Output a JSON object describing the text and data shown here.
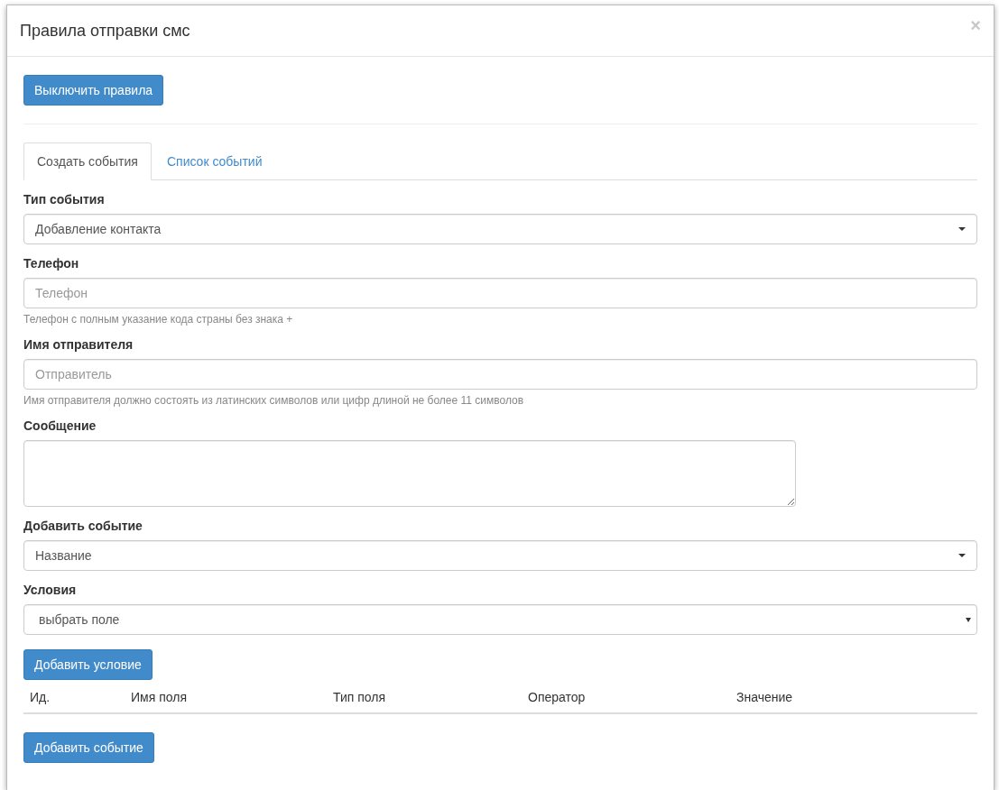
{
  "window": {
    "title": "Правила отправки смс",
    "close": "×"
  },
  "toggle_button": "Выключить правила",
  "tabs": [
    {
      "label": "Создать события",
      "selected": true
    },
    {
      "label": "Список событий",
      "selected": false
    }
  ],
  "fields": [
    {
      "kind": "select",
      "label": "Тип события",
      "value": "Добавление контакта"
    },
    {
      "kind": "text",
      "label": "Телефон",
      "placeholder": "Телефон",
      "help": "Телефон с полным указание кода страны без знака +"
    },
    {
      "kind": "text",
      "label": "Имя отправителя",
      "placeholder": "Отправитель",
      "help": "Имя отправителя должно состоять из латинских символов или цифр длиной не более 11 символов"
    },
    {
      "kind": "textarea",
      "label": "Сообщение"
    },
    {
      "kind": "select",
      "label": "Добавить событие",
      "value": "Название"
    },
    {
      "kind": "native-select",
      "label": "Условия",
      "value": "выбрать поле"
    }
  ],
  "add_condition_button": "Добавить условие",
  "table": {
    "columns": [
      "Ид.",
      "Имя поля",
      "Тип поля",
      "Оператор",
      "Значение"
    ]
  },
  "add_event_button": "Добавить событие"
}
